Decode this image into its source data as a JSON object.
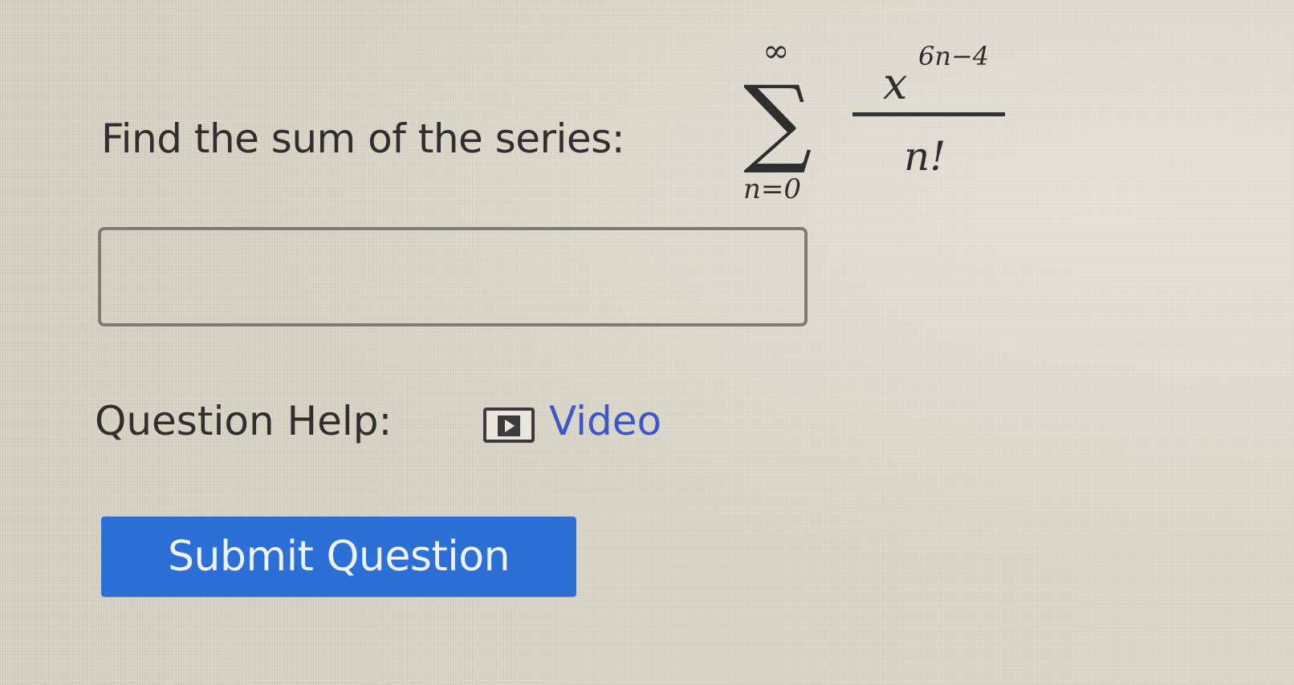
{
  "question": {
    "prompt": "Find the sum of the series:",
    "series": {
      "upper_limit": "∞",
      "lower_limit": "n=0",
      "numerator_base": "x",
      "numerator_exponent": "6n−4",
      "denominator": "n!"
    }
  },
  "answer": {
    "value": "",
    "placeholder": ""
  },
  "help": {
    "label": "Question Help:",
    "video_label": "Video",
    "video_icon": "video-play-icon"
  },
  "submit": {
    "label": "Submit Question"
  },
  "colors": {
    "link": "#3d57c8",
    "button": "#2c6fd6"
  }
}
